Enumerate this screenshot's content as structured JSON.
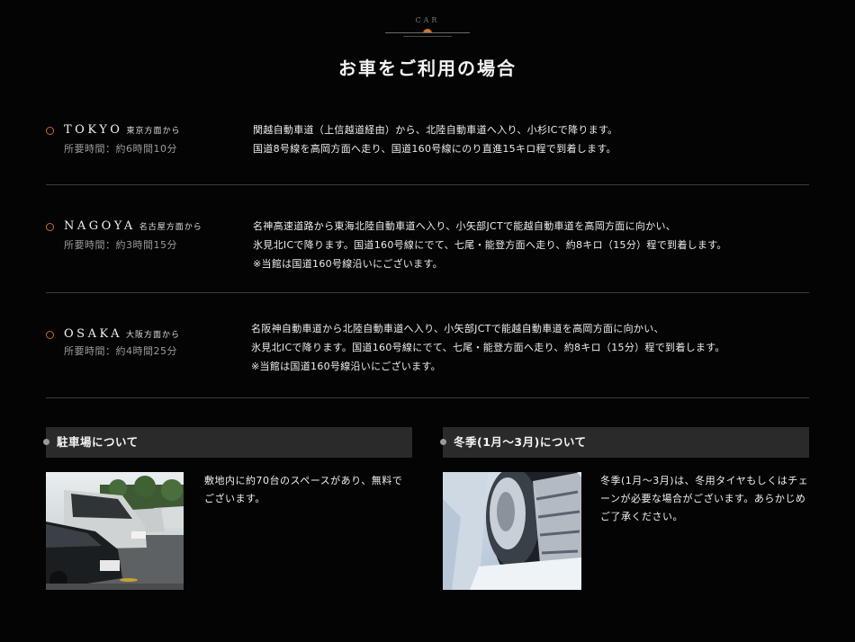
{
  "header": {
    "emblem_label": "CAR",
    "title": "お車をご利用の場合"
  },
  "routes": [
    {
      "city": "TOKYO",
      "direction": "東京方面から",
      "time": "所要時間：約6時間10分",
      "lines": [
        "関越自動車道（上信越道経由）から、北陸自動車道へ入り、小杉ICで降ります。",
        "国道8号線を高岡方面へ走り、国道160号線にのり直進15キロ程で到着します。"
      ]
    },
    {
      "city": "NAGOYA",
      "direction": "名古屋方面から",
      "time": "所要時間：約3時間15分",
      "lines": [
        "名神高速道路から東海北陸自動車道へ入り、小矢部JCTで能越自動車道を高岡方面に向かい、",
        "氷見北ICで降ります。国道160号線にでて、七尾・能登方面へ走り、約8キロ（15分）程で到着します。",
        "※当館は国道160号線沿いにございます。"
      ]
    },
    {
      "city": "OSAKA",
      "direction": "大阪方面から",
      "time": "所要時間：約4時間25分",
      "lines": [
        "名阪神自動車道から北陸自動車道へ入り、小矢部JCTで能越自動車道を高岡方面に向かい、",
        "氷見北ICで降ります。国道160号線にでて、七尾・能登方面へ走り、約8キロ（15分）程で到着します。",
        "※当館は国道160号線沿いにございます。"
      ]
    }
  ],
  "parking": {
    "heading": "駐車場について",
    "lines": [
      "敷地内に約70台のスペースがあり、無料で",
      "ございます。"
    ]
  },
  "winter": {
    "heading": "冬季(1月～3月)について",
    "lines": [
      "冬季(1月～3月)は、冬用タイヤもしくはチェ",
      "ーンが必要な場合がございます。あらかじめ",
      "ご了承ください。"
    ]
  },
  "colors": {
    "accent": "#c96a32",
    "background": "#040404",
    "box_header": "#2a2a2a"
  }
}
